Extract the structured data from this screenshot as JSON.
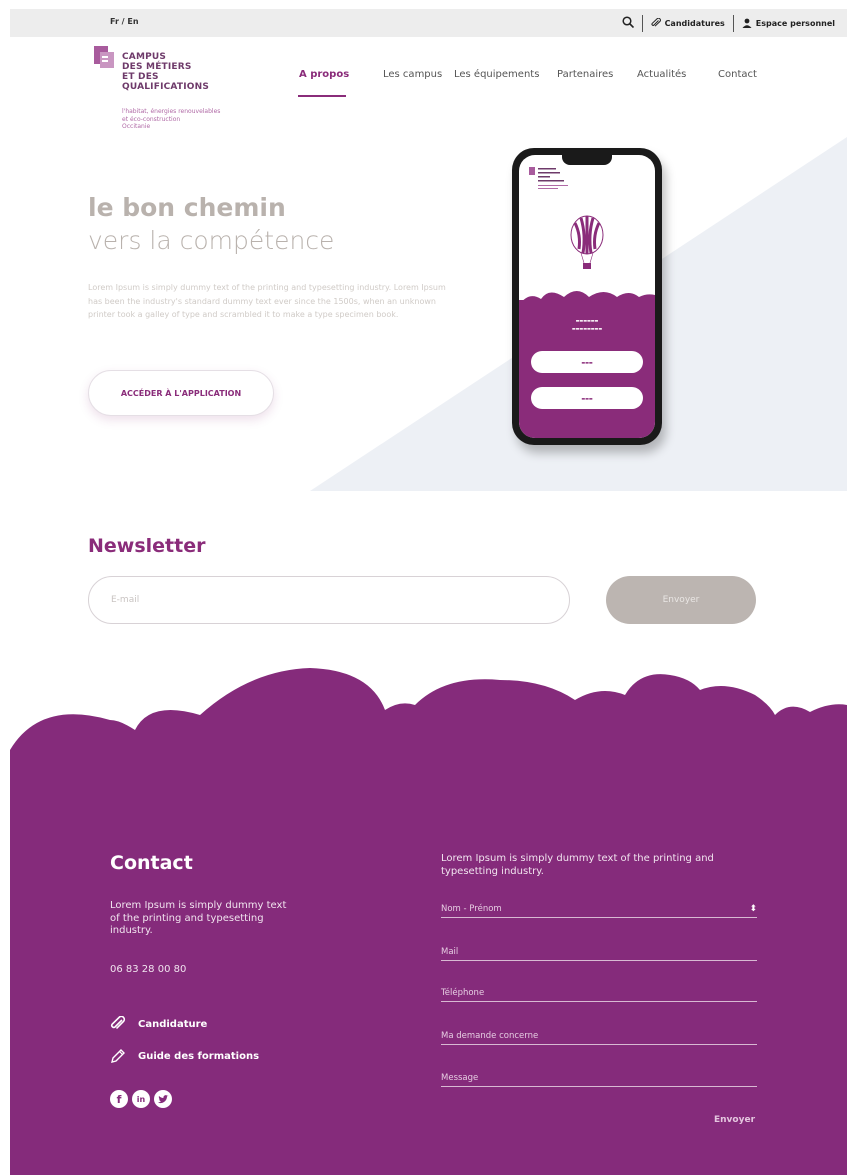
{
  "topbar": {
    "language": "Fr / En",
    "applications": "Candidatures",
    "personal_space": "Espace personnel"
  },
  "logo": {
    "lines": [
      "CAMPUS",
      "DES MÉTIERS",
      "ET DES",
      "QUALIFICATIONS"
    ],
    "subtitle": [
      "l'habitat, énergies renouvelables",
      "et éco-construction",
      "Occitanie"
    ]
  },
  "nav": {
    "items": [
      "A propos",
      "Les campus",
      "Les équipements",
      "Partenaires",
      "Actualités",
      "Contact"
    ],
    "active": "A propos"
  },
  "hero": {
    "title": "le bon chemin",
    "subtitle": "vers la compétence",
    "text": "Lorem Ipsum is simply dummy text of the printing and typesetting industry. Lorem Ipsum has been the industry's standard dummy text ever since the 1500s, when an unknown printer took a galley of type and scrambled it to make a type specimen book.",
    "button": "ACCÉDER À L'APPLICATION"
  },
  "newsletter": {
    "title": "Newsletter",
    "email_placeholder": "E-mail",
    "button": "Envoyer"
  },
  "footer": {
    "contact_title": "Contact",
    "contact_text": "Lorem Ipsum is simply dummy text of the printing and typesetting industry.",
    "phone": "06 83 28 00 80",
    "links": [
      "Candidature",
      "Guide des formations"
    ],
    "social": [
      "facebook-icon",
      "linkedin-icon",
      "twitter-icon"
    ],
    "form_intro": "Lorem Ipsum is simply dummy text of the printing and typesetting industry.",
    "fields": [
      "Nom - Prénom",
      "Mail",
      "Téléphone",
      "Ma demande concerne",
      "Message"
    ],
    "send": "Envoyer"
  },
  "colors": {
    "brand": "#852b7b",
    "accent": "#8a2c7a",
    "muted": "#b9b2ad"
  }
}
